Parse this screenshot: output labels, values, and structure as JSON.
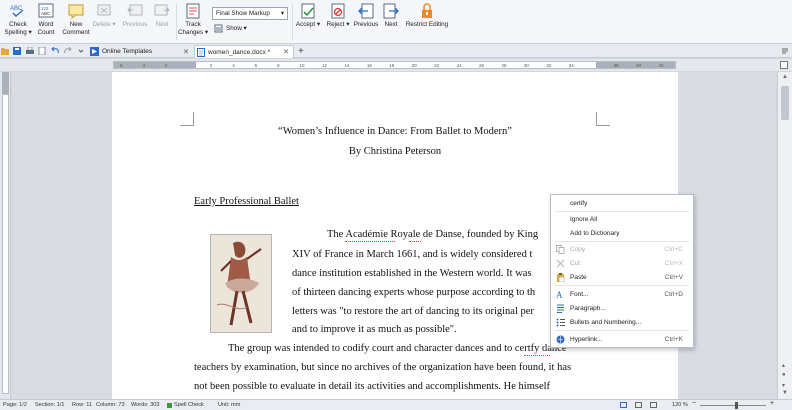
{
  "ribbon": {
    "buttons": [
      {
        "id": "check-spelling",
        "label": "Check\nSpelling ▾",
        "dim": false
      },
      {
        "id": "word-count",
        "label": "Word\nCount",
        "dim": false
      },
      {
        "id": "new-comment",
        "label": "New\nComment",
        "dim": false
      },
      {
        "id": "delete",
        "label": "Delete ▾",
        "dim": true
      },
      {
        "id": "previous-comment",
        "label": "Previous",
        "dim": true
      },
      {
        "id": "next-comment",
        "label": "Next",
        "dim": true
      },
      {
        "id": "track-changes",
        "label": "Track\nChanges ▾",
        "dim": false
      },
      {
        "id": "accept",
        "label": "Accept ▾",
        "dim": false
      },
      {
        "id": "reject",
        "label": "Reject ▾",
        "dim": false
      },
      {
        "id": "previous-change",
        "label": "Previous",
        "dim": false
      },
      {
        "id": "next-change",
        "label": "Next",
        "dim": false
      },
      {
        "id": "restrict-editing",
        "label": "Restrict Editing",
        "dim": false
      }
    ],
    "markup_value": "Final Show Markup",
    "show_label": "Show ▾"
  },
  "tabs": [
    {
      "label": "Online Templates",
      "active": false
    },
    {
      "label": "women_dance.docx *",
      "active": true
    }
  ],
  "ruler_numbers": [
    "6",
    "4",
    "2",
    "",
    "2",
    "4",
    "6",
    "8",
    "10",
    "12",
    "14",
    "16",
    "18",
    "20",
    "22",
    "24",
    "26",
    "28",
    "30",
    "32",
    "34",
    "",
    "38",
    "40",
    "42"
  ],
  "document": {
    "title": "“Women’s Influence in Dance: From Ballet to Modern”",
    "author": "By Christina Peterson",
    "heading": "Early Professional Ballet",
    "lines": [
      {
        "text": "The Académie Royale de Danse, founded by King"
      },
      {
        "text": "XIV of France in March 1661, and is widely considered t"
      },
      {
        "text": "dance institution established in the Western world. It was"
      },
      {
        "text": "of thirteen dancing experts whose purpose according to th"
      },
      {
        "text": "letters was \"to restore the art of dancing to its original per"
      },
      {
        "text": "and to improve it as much as possible\"."
      },
      {
        "text": "The group was intended to codify court and character dances and to certfy dance"
      },
      {
        "text": "teachers by examination, but since no archives of the organization have been found, it has"
      },
      {
        "text": "not been possible to evaluate in detail its activities and accomplishments. He himself"
      }
    ]
  },
  "context_menu": {
    "items": [
      {
        "label": "certify",
        "shortcut": "",
        "icon": "",
        "dim": false
      },
      {
        "label": "Ignore All",
        "shortcut": "",
        "icon": "",
        "dim": false
      },
      {
        "label": "Add to Dictionary",
        "shortcut": "",
        "icon": "",
        "dim": false
      },
      {
        "label": "Copy",
        "shortcut": "Ctrl+C",
        "icon": "copy-icon",
        "dim": true
      },
      {
        "label": "Cut",
        "shortcut": "Ctrl+X",
        "icon": "cut-icon",
        "dim": true
      },
      {
        "label": "Paste",
        "shortcut": "Ctrl+V",
        "icon": "paste-icon",
        "dim": false
      },
      {
        "label": "Font...",
        "shortcut": "Ctrl+D",
        "icon": "font-icon",
        "dim": false
      },
      {
        "label": "Paragraph...",
        "shortcut": "",
        "icon": "paragraph-icon",
        "dim": false
      },
      {
        "label": "Bullets and Numbering...",
        "shortcut": "",
        "icon": "bullets-icon",
        "dim": false
      },
      {
        "label": "Hyperlink...",
        "shortcut": "Ctrl+K",
        "icon": "hyperlink-icon",
        "dim": false
      }
    ]
  },
  "status": {
    "page": "Page: 1/2",
    "section": "Section: 1/1",
    "row": "Row: 11",
    "column": "Column: 73",
    "words": "Words: 303",
    "spell": "Spell Check",
    "unit": "Unit: mm",
    "zoom": "120 %"
  },
  "colors": {
    "accent": "#2b6cc4",
    "spell_error": "#e03a3a",
    "lock": "#e8892b"
  }
}
